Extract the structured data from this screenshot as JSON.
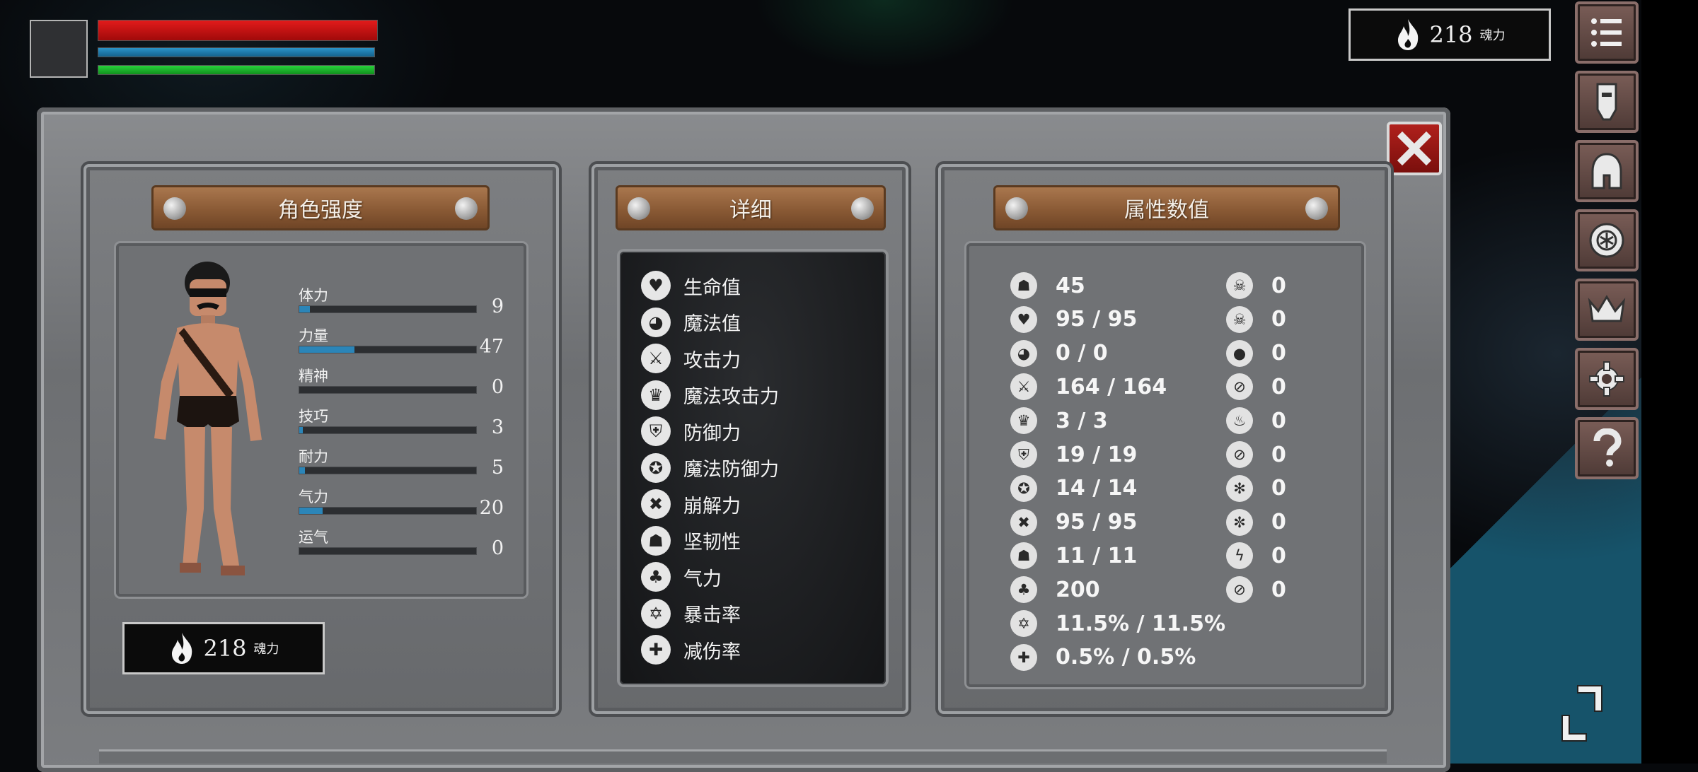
{
  "hud": {
    "soul_value": "218",
    "soul_unit": "魂力"
  },
  "panels": {
    "character": {
      "title": "角色强度"
    },
    "details": {
      "title": "详细"
    },
    "attributes": {
      "title": "属性数值"
    }
  },
  "stats": [
    {
      "label": "体力",
      "value": "9",
      "fill": 0.06
    },
    {
      "label": "力量",
      "value": "47",
      "fill": 0.31
    },
    {
      "label": "精神",
      "value": "0",
      "fill": 0
    },
    {
      "label": "技巧",
      "value": "3",
      "fill": 0.02
    },
    {
      "label": "耐力",
      "value": "5",
      "fill": 0.03
    },
    {
      "label": "气力",
      "value": "20",
      "fill": 0.13
    },
    {
      "label": "运气",
      "value": "0",
      "fill": 0
    }
  ],
  "details": [
    {
      "icon": "heart-icon",
      "glyph": "♥",
      "label": "生命值"
    },
    {
      "icon": "head-icon",
      "glyph": "◕",
      "label": "魔法值"
    },
    {
      "icon": "sword-icon",
      "glyph": "⚔",
      "label": "攻击力"
    },
    {
      "icon": "magic-attack-icon",
      "glyph": "♛",
      "label": "魔法攻击力"
    },
    {
      "icon": "shield-icon",
      "glyph": "⛨",
      "label": "防御力"
    },
    {
      "icon": "magic-shield-icon",
      "glyph": "✪",
      "label": "魔法防御力"
    },
    {
      "icon": "break-hammer-icon",
      "glyph": "✖",
      "label": "崩解力"
    },
    {
      "icon": "knight-helm-icon",
      "glyph": "☗",
      "label": "坚韧性"
    },
    {
      "icon": "lungs-icon",
      "glyph": "♣",
      "label": "气力"
    },
    {
      "icon": "crit-star-icon",
      "glyph": "✡",
      "label": "暴击率"
    },
    {
      "icon": "reduction-icon",
      "glyph": "✚",
      "label": "减伤率"
    }
  ],
  "attributes_left": [
    {
      "icon": "helmet-icon",
      "glyph": "☗",
      "value": "45"
    },
    {
      "icon": "heart-icon",
      "glyph": "♥",
      "value": "95 / 95"
    },
    {
      "icon": "head-icon",
      "glyph": "◕",
      "value": "0 / 0"
    },
    {
      "icon": "sword-icon",
      "glyph": "⚔",
      "value": "164 / 164"
    },
    {
      "icon": "magic-attack-icon",
      "glyph": "♛",
      "value": "3 / 3"
    },
    {
      "icon": "shield-icon",
      "glyph": "⛨",
      "value": "19 / 19"
    },
    {
      "icon": "magic-shield-icon",
      "glyph": "✪",
      "value": "14 / 14"
    },
    {
      "icon": "break-hammer-icon",
      "glyph": "✖",
      "value": "95 / 95"
    },
    {
      "icon": "knight-helm-icon",
      "glyph": "☗",
      "value": "11 / 11"
    },
    {
      "icon": "lungs-icon",
      "glyph": "♣",
      "value": "200"
    },
    {
      "icon": "crit-star-icon",
      "glyph": "✡",
      "value": "11.5% / 11.5%"
    },
    {
      "icon": "reduction-icon",
      "glyph": "✚",
      "value": "0.5% / 0.5%"
    }
  ],
  "attributes_right": [
    {
      "icon": "skull-icon",
      "glyph": "☠",
      "value": "0"
    },
    {
      "icon": "skull-crossed-icon",
      "glyph": "☠",
      "value": "0"
    },
    {
      "icon": "drop-icon",
      "glyph": "●",
      "value": "0"
    },
    {
      "icon": "drop-crossed-icon",
      "glyph": "⊘",
      "value": "0"
    },
    {
      "icon": "fire-icon",
      "glyph": "♨",
      "value": "0"
    },
    {
      "icon": "fire-crossed-icon",
      "glyph": "⊘",
      "value": "0"
    },
    {
      "icon": "frost-icon",
      "glyph": "✻",
      "value": "0"
    },
    {
      "icon": "frost-crossed-icon",
      "glyph": "✼",
      "value": "0"
    },
    {
      "icon": "lightning-icon",
      "glyph": "ϟ",
      "value": "0"
    },
    {
      "icon": "lightning-crossed-icon",
      "glyph": "⊘",
      "value": "0"
    }
  ],
  "bars": {
    "health_fill": 1.0,
    "mana_fill": 1.0,
    "stamina_fill": 1.0
  },
  "colors": {
    "health": "#e21b1b",
    "mana": "#2b93c9",
    "stamina": "#27d23b",
    "close": "#b0201c",
    "plank": "#8a5a35"
  },
  "nav": [
    "menu-list-icon",
    "character-icon",
    "helmet-icon",
    "emblem-icon",
    "crown-icon",
    "settings-gear-icon",
    "help-question-icon"
  ]
}
